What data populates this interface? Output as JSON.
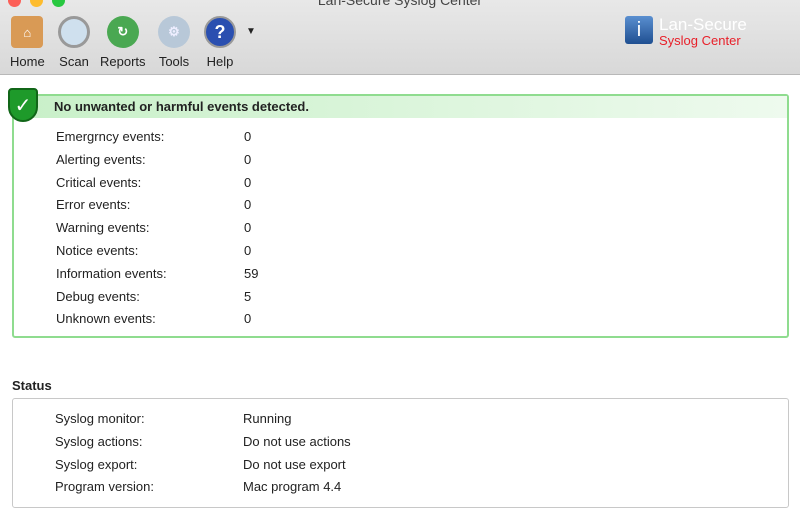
{
  "window": {
    "title": "Lan-Secure Syslog Center"
  },
  "toolbar": {
    "items": [
      {
        "label": "Home",
        "icon": "home-icon"
      },
      {
        "label": "Scan",
        "icon": "magnifier-icon"
      },
      {
        "label": "Reports",
        "icon": "reports-icon"
      },
      {
        "label": "Tools",
        "icon": "gear-icon"
      },
      {
        "label": "Help",
        "icon": "help-icon"
      }
    ]
  },
  "logo": {
    "line1": "Lan-Secure",
    "line2": "Syslog Center"
  },
  "events": {
    "banner": "No unwanted or harmful events detected.",
    "rows": [
      {
        "label": "Emergrncy events:",
        "value": "0"
      },
      {
        "label": "Alerting events:",
        "value": "0"
      },
      {
        "label": "Critical events:",
        "value": "0"
      },
      {
        "label": "Error events:",
        "value": "0"
      },
      {
        "label": "Warning events:",
        "value": "0"
      },
      {
        "label": "Notice events:",
        "value": "0"
      },
      {
        "label": "Information events:",
        "value": "59"
      },
      {
        "label": "Debug events:",
        "value": "5"
      },
      {
        "label": "Unknown events:",
        "value": "0"
      }
    ]
  },
  "status": {
    "heading": "Status",
    "rows": [
      {
        "label": "Syslog monitor:",
        "value": "Running"
      },
      {
        "label": "Syslog actions:",
        "value": "Do not use actions"
      },
      {
        "label": "Syslog export:",
        "value": "Do not use export"
      },
      {
        "label": "Program version:",
        "value": "Mac program 4.4"
      }
    ]
  }
}
